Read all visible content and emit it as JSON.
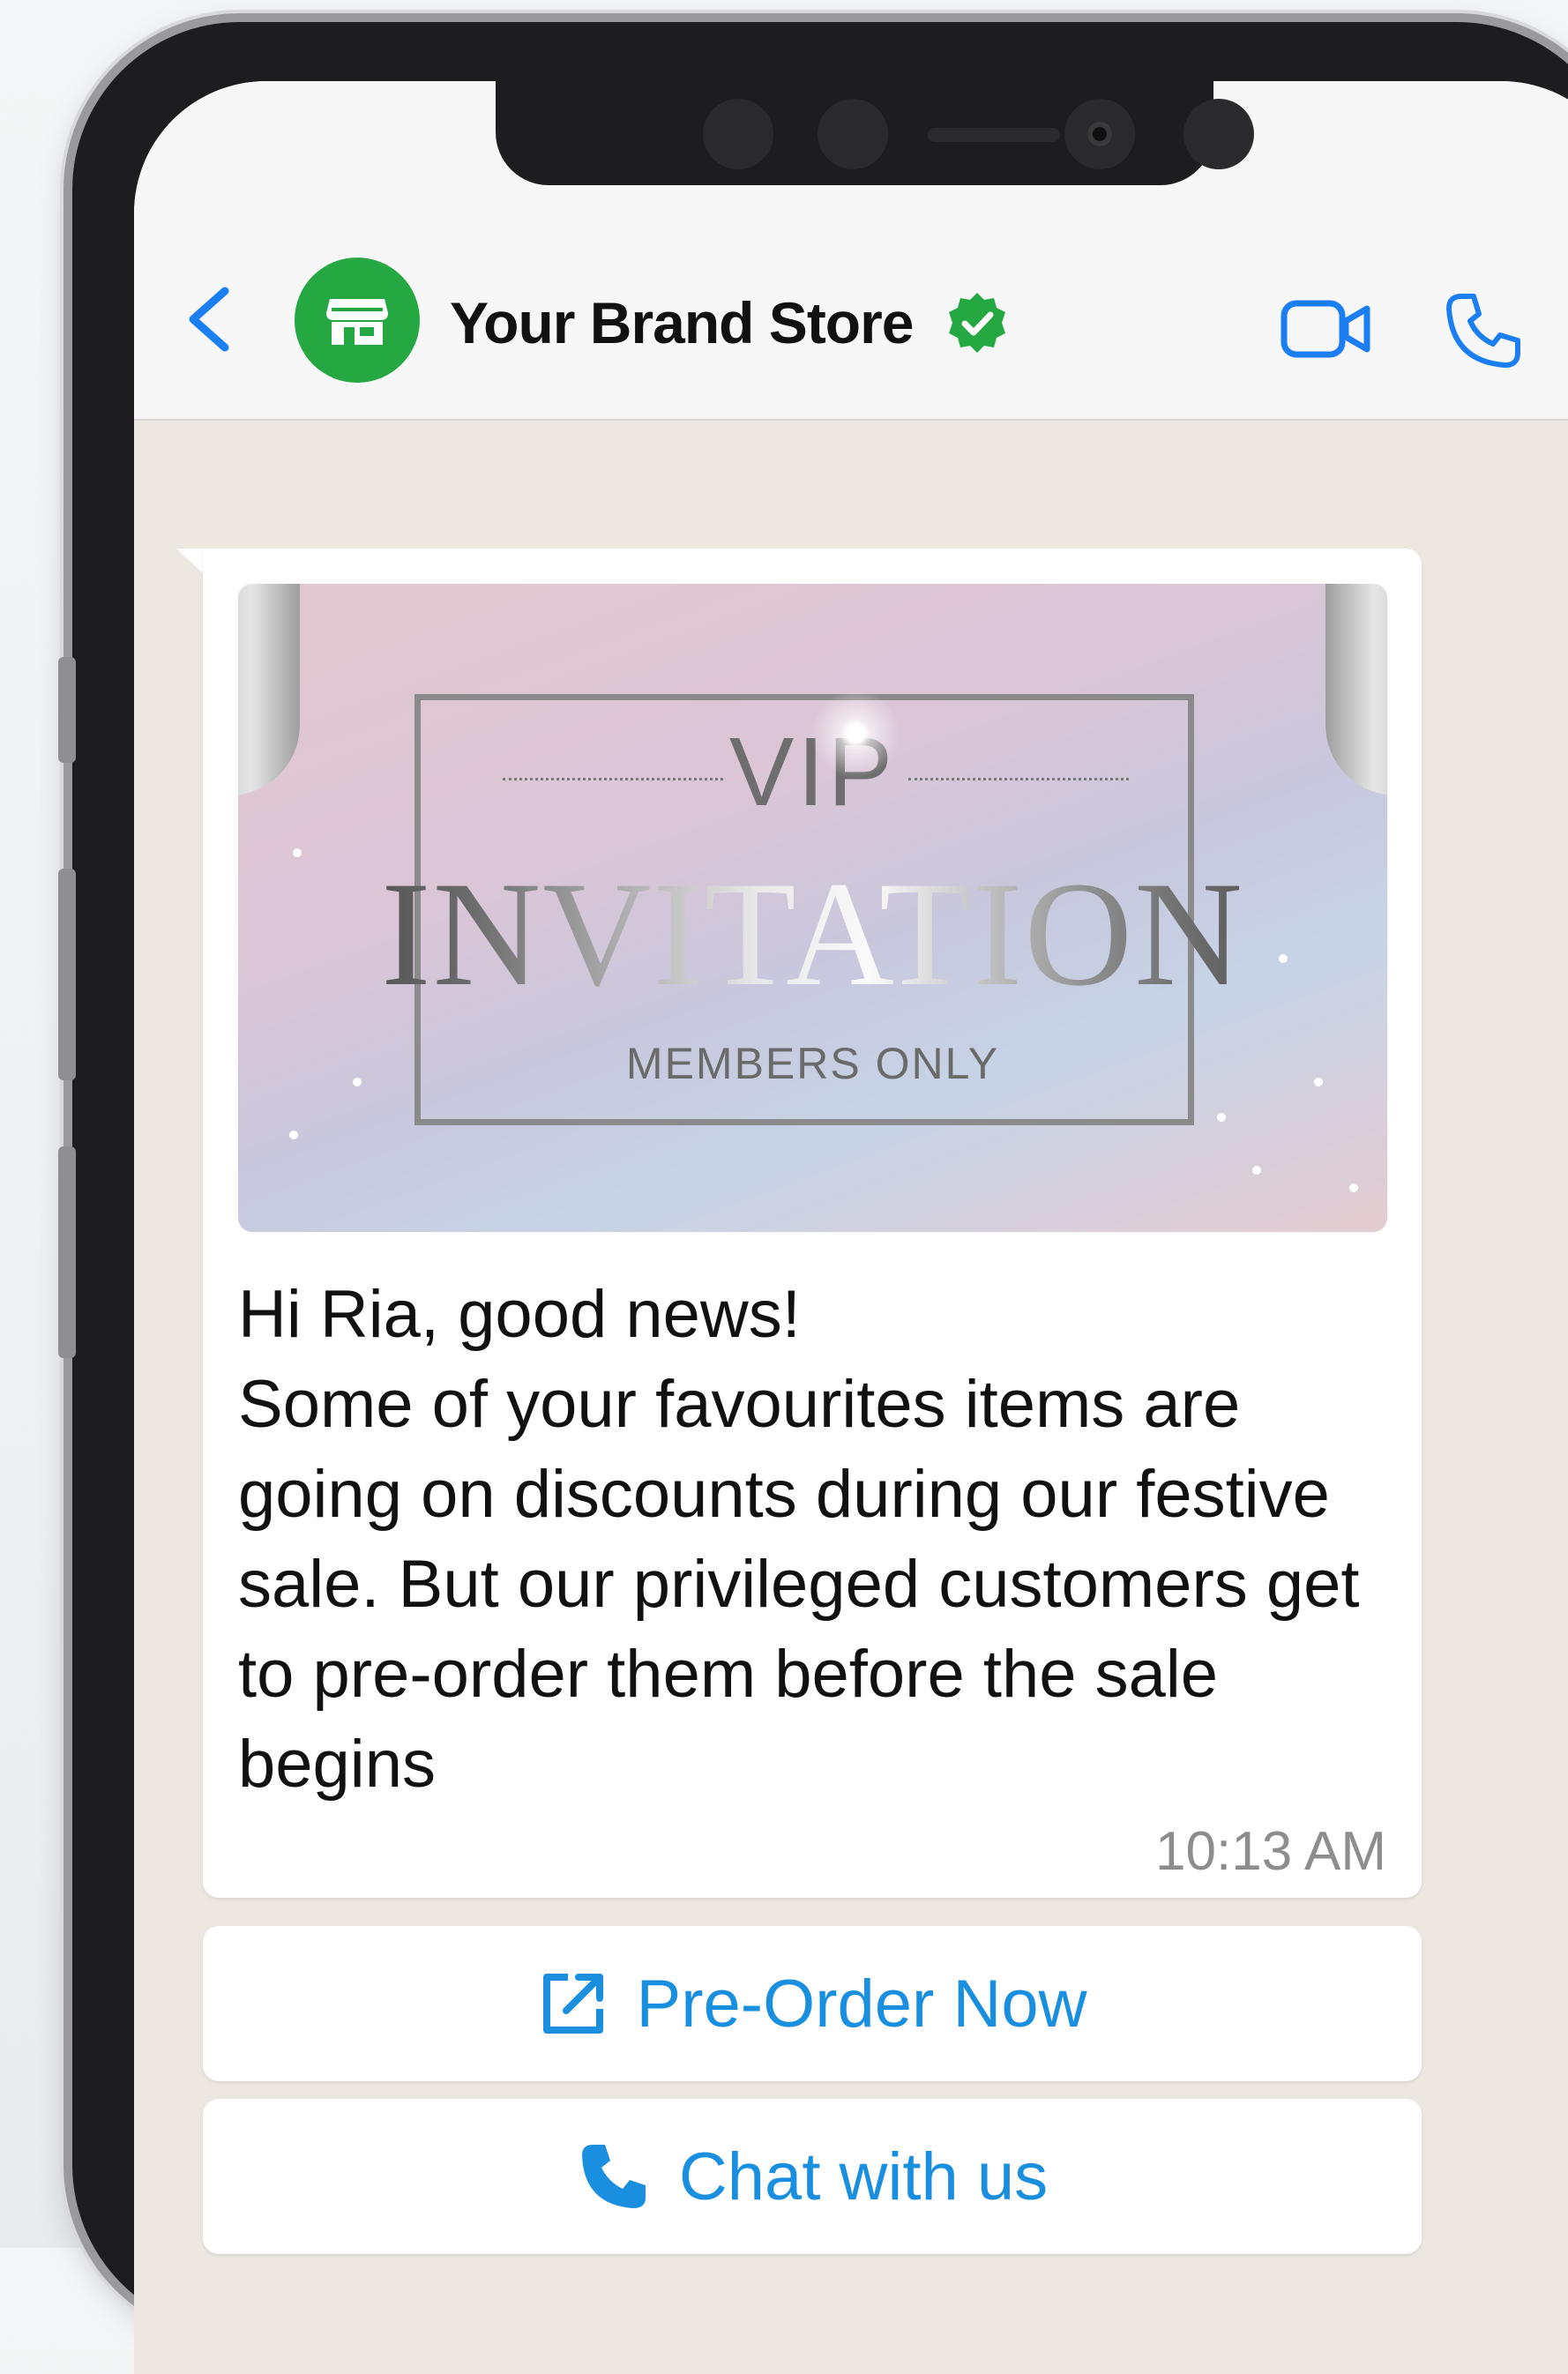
{
  "header": {
    "brand_name": "Your Brand Store",
    "avatar_icon": "store-icon",
    "verified_icon": "verified-badge-icon",
    "back_icon": "chevron-left-icon",
    "video_icon": "video-camera-icon",
    "call_icon": "phone-icon"
  },
  "banner": {
    "title": "VIP",
    "headline": "INVITATION",
    "subtitle": "MEMBERS ONLY"
  },
  "message": {
    "text": "Hi Ria, good news!\nSome of your favourites items are going on discounts during our festive sale. But our privileged customers get to pre-order them before the sale begins",
    "time": "10:13 AM"
  },
  "buttons": [
    {
      "label": "Pre-Order Now",
      "icon": "external-link-icon"
    },
    {
      "label": "Chat with us",
      "icon": "phone-icon"
    }
  ],
  "colors": {
    "accent": "#1a8fe0",
    "avatar_bg": "#25a741",
    "verified": "#25a741",
    "ios_blue": "#1b7ef2"
  }
}
